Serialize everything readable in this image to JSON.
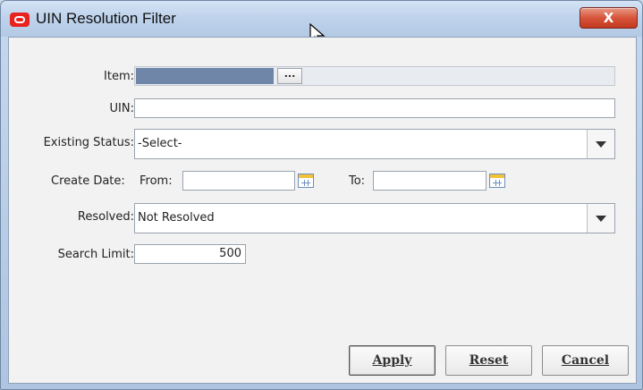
{
  "window": {
    "title": "UIN Resolution Filter",
    "close_label": "X"
  },
  "form": {
    "item_label": "Item:",
    "item_browse_label": "...",
    "uin_label": "UIN:",
    "uin_value": "",
    "existing_status_label": "Existing Status:",
    "existing_status_value": "-Select-",
    "create_date_label": "Create Date:",
    "from_label": "From:",
    "from_value": "",
    "to_label": "To:",
    "to_value": "",
    "resolved_label": "Resolved:",
    "resolved_value": "Not Resolved",
    "search_limit_label": "Search Limit:",
    "search_limit_value": "500"
  },
  "buttons": {
    "apply": "Apply",
    "reset": "Reset",
    "cancel": "Cancel"
  },
  "colors": {
    "brand": "#e8231f",
    "close": "#d6553b",
    "item_selected": "#6f86a8"
  }
}
